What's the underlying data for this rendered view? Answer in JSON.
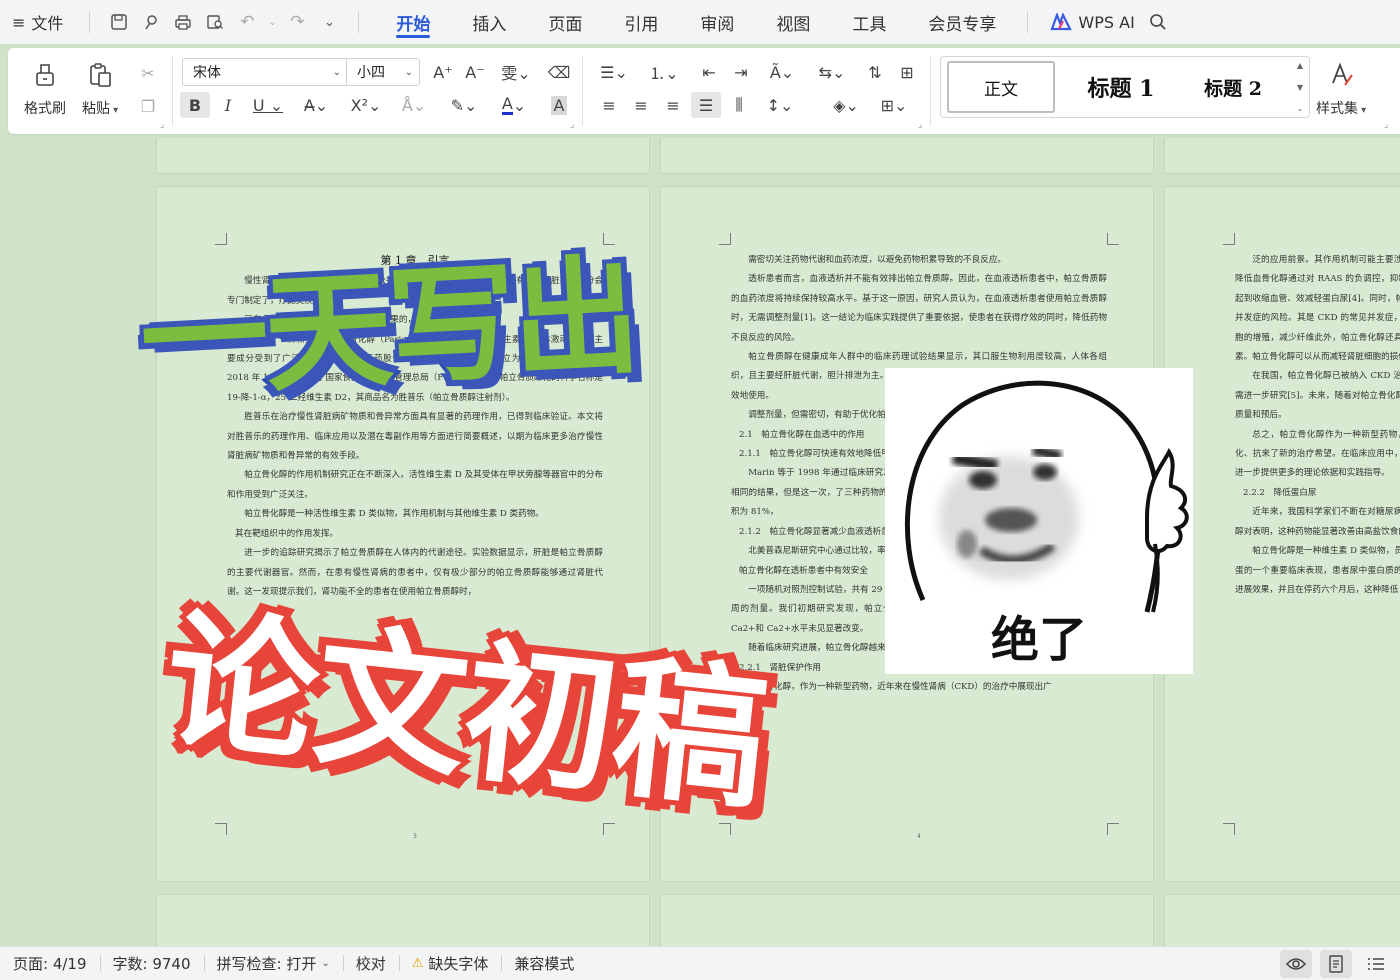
{
  "menubar": {
    "menu_icon": "≡",
    "file_label": "文件",
    "tabs": [
      {
        "label": "开始",
        "active": true
      },
      {
        "label": "插入"
      },
      {
        "label": "页面"
      },
      {
        "label": "引用"
      },
      {
        "label": "审阅"
      },
      {
        "label": "视图"
      },
      {
        "label": "工具"
      },
      {
        "label": "会员专享"
      }
    ],
    "ai_label": "WPS AI"
  },
  "ribbon": {
    "format_painter": "格式刷",
    "paste": "粘贴",
    "font_name": "宋体",
    "font_size": "小四",
    "styles": {
      "normal": "正文",
      "heading1": "标题 1",
      "heading2": "标题 2"
    },
    "style_set": "样式集"
  },
  "pages": {
    "p1": {
      "chapter_title": "第 1 章　引言",
      "paragraphs": [
        "慢性肾脏疾病（CKD）已成为我国公共卫生领域的一个重要问题，国患有慢性肾脏病人，分会专门制定了，疗此类疾病。",
        "已有多种药物可供选择，但具有显著效果的，物治疗的药物。",
        "近年来，一种新型药物帕立骨化醇（Paricalcitol）是一种选择性维生素 D 受体激动剂，其主要成分受到了广泛关注。江苏恒瑞医药股份有限公司成功研发了以帕立为原料的仿制药，并于 2018 年 1 月 2 日获得了国家食品药品监督管理总局（FDA）的批准。帕立骨质醇化的科学名称是 19-降-1-α，25-二羟维生素 D2，其商品名为胜普乐（帕立骨质醇注射剂）。",
        "胜普乐在治疗慢性肾脏病矿物质和骨异常方面具有显著的药理作用，已得到临床验证。本文将对胜普乐的药理作用、临床应用以及潜在毒副作用等方面进行简要概述，以期为临床更多治疗慢性肾脏病矿物质和骨异常的有效手段。",
        "帕立骨化醇的作用机制研究正在不断深入，活性维生素 D 及其受体在甲状旁腺等器官中的分布和作用受到广泛关注。",
        "帕立骨化醇是一种活性维生素 D 类似物，其作用机制与其他维生素 D 类药物。",
        "其在靶组织中的作用发挥。",
        "进一步的追踪研究揭示了帕立骨质醇在人体内的代谢途径。实验数据显示，肝脏是帕立骨质醇的主要代谢器官。然而，在患有慢性肾病的患者中，仅有极少部分的帕立骨质醇能够通过肾脏代谢。这一发现提示我们，肾功能不全的患者在使用帕立骨质醇时，"
      ],
      "page_number": "3"
    },
    "p2": {
      "paragraphs": [
        "需密切关注药物代谢和血药浓度，以避免药物积累导致的不良反应。",
        "透析患者而言，血液透析并不能有效排出帕立骨质醇。因此，在血液透析患者中，帕立骨质醇的血药浓度将持续保持较高水平。基于这一原因，研究人员认为，在血液透析患者使用帕立骨质醇时，无需调整剂量[1]。这一结论为临床实践提供了重要依据，使患者在获得疗效的同时，降低药物不良反应的风险。",
        "帕立骨质醇在健康成年人群中的临床药理试验结果显示，其口服生物利用度较高，人体各组织，且主要经肝脏代谢，胆汁排泄为主。在老年患者中，帕立骨质醇的药代动力学，以确保安全有效地使用。",
        "调整剂量，但需密切，有助于优化帕立骨质醇的治疗。",
        "2.1　帕立骨化醇在血透中的作用",
        "2.1.1　帕立骨化醇可快速有效地降低甲状旁腺激素",
        "Marin 等于 1998 年通过临床研究发现，只有 8%，且在试验前后，iPTH 下降，中也得到了相同的结果，但是这一次，了三种药物的治疗[2]。另有 67 名血液透析，治疗 13 个月后，钙磷乘积为 81%，",
        "2.1.2　帕立骨化醇显著减少血液透析患者",
        "北美普森尼斯研究中心通过比较，率下降率为 16.0%的降低，（0.001）[3]。帕立",
        "帕立骨化醇在透析患者中有效安全",
        "一项随机对照剂控制试验，共有 29 名年龄介于 5 至 19 的血液透析病人接受 Paricalcitol 12 周的剂量。我们初期研究发现，帕立骨化醇治疗后，60%的患者，中 iPTH 下降 30%，而 Ca2+和 Ca2+水平未见显著改变。",
        "随着临床研究进展，帕立骨化醇越来越多显示出其多效性。",
        "2.2.1　肾脏保护作用",
        "帕立骨化醇，作为一种新型药物，近年来在慢性肾病（CKD）的治疗中展现出广"
      ],
      "page_number": "4"
    },
    "p3": {
      "paragraphs": [
        "泛的应用前景。其作用机制可能主要涉及负调控，从而达到降低蛋白尿、降低血骨化醇通过对 RAAS 的负调控，抑制肾素血管紧张素 II 在肾脏疾病中起到收缩血管、效减轻蛋白尿[4]。同时，帕立骨化醇还可低血压，改善心血管并发症的风险。其是 CKD 的常见并发症，是由于细胞外以通过抑制纤维母细胞的增殖，减少纤维此外，帕立骨化醇还具有抗氧化、抗炎肾脏损伤的重要因素。帕立骨化醇可以从而减轻肾脏细胞的损伤。",
        "在我国，帕立骨化醇已被纳入 CKD 治疗意义。然而，其具体作用机制仍需进一步研究[5]。未来，随着对帕立骨化醇研究的深入，用，改善患者的生存质量和预后。",
        "总之，帕立骨化醇作为一种新型药物，过调控 RAAS、抗纤维化、抗氧化、抗来了新的治疗希望。在临床应用中，需为患者带来更好的疗效。同时，进一步提供更多的理论依据和实践指导。",
        "2.2.2　降低蛋白尿",
        "近年来，我国科学家们不断在对糖尿病显成果。其中，一项关于帕立骨化醇对表明，这种药物能显著改善由高盐饮食的可能。",
        "帕立骨化醇是一种维生素 D 类似物，员发现，它在改善 2 型糖尿病患者的蛋的一个重要临床表现，患者尿中蛋白质的控制蛋白尿对于延缓糖尿病肾病的进展效果，并且在停药六个月后，这种降低"
      ]
    }
  },
  "overlay": {
    "title_line1": "一天写出",
    "title_line2": "论文初稿",
    "meme_caption": "绝了"
  },
  "statusbar": {
    "page": "页面: 4/19",
    "words": "字数: 9740",
    "spell": "拼写检查: 打开",
    "proof": "校对",
    "missing_font": "缺失字体",
    "compat": "兼容模式"
  },
  "colors": {
    "accent": "#2a5bd7",
    "doc_bg": "#cfe3c9",
    "page_bg": "#d8ebd2",
    "title1_fill": "#7bbd3f",
    "title1_stroke": "#2f4fb0",
    "title2_fill": "#ffffff",
    "title2_stroke": "#e8453a"
  }
}
